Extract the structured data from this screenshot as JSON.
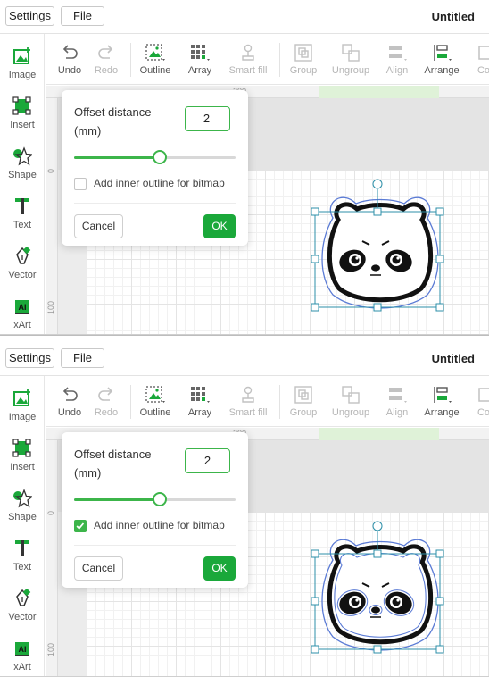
{
  "topbar": {
    "settings_label": "Settings",
    "file_label": "File",
    "doc_title": "Untitled"
  },
  "sidebar": {
    "items": [
      {
        "label": "Image",
        "icon": "image-add-icon"
      },
      {
        "label": "Insert",
        "icon": "insert-icon"
      },
      {
        "label": "Shape",
        "icon": "shape-star-icon"
      },
      {
        "label": "Text",
        "icon": "text-icon"
      },
      {
        "label": "Vector",
        "icon": "pen-vector-icon"
      },
      {
        "label": "xArt",
        "icon": "xart-ai-icon"
      }
    ]
  },
  "toolbar": {
    "items": [
      {
        "label": "Undo",
        "enabled": true
      },
      {
        "label": "Redo",
        "enabled": false
      },
      {
        "label": "Outline",
        "enabled": true
      },
      {
        "label": "Array",
        "enabled": true
      },
      {
        "label": "Smart fill",
        "enabled": false
      },
      {
        "label": "Group",
        "enabled": false
      },
      {
        "label": "Ungroup",
        "enabled": false
      },
      {
        "label": "Align",
        "enabled": false
      },
      {
        "label": "Arrange",
        "enabled": true
      },
      {
        "label": "Co",
        "enabled": false
      }
    ]
  },
  "ruler": {
    "top_numbers": [
      "200"
    ],
    "left_numbers": [
      "0",
      "100"
    ]
  },
  "colors": {
    "accent": "#1aa83a",
    "accent_light": "#3cb54a",
    "selection": "#2c8fa8",
    "outline": "#5b7bd5"
  },
  "panels": [
    {
      "popup": {
        "title": "Offset distance (mm)",
        "input_value": "2",
        "input_has_caret": true,
        "slider_fraction": 0.53,
        "checkbox_label": "Add inner outline for bitmap",
        "checkbox_checked": false,
        "cancel_label": "Cancel",
        "ok_label": "OK"
      },
      "inner_outline": false
    },
    {
      "popup": {
        "title": "Offset distance (mm)",
        "input_value": "2",
        "input_has_caret": false,
        "slider_fraction": 0.53,
        "checkbox_label": "Add inner outline for bitmap",
        "checkbox_checked": true,
        "cancel_label": "Cancel",
        "ok_label": "OK"
      },
      "inner_outline": true
    }
  ]
}
